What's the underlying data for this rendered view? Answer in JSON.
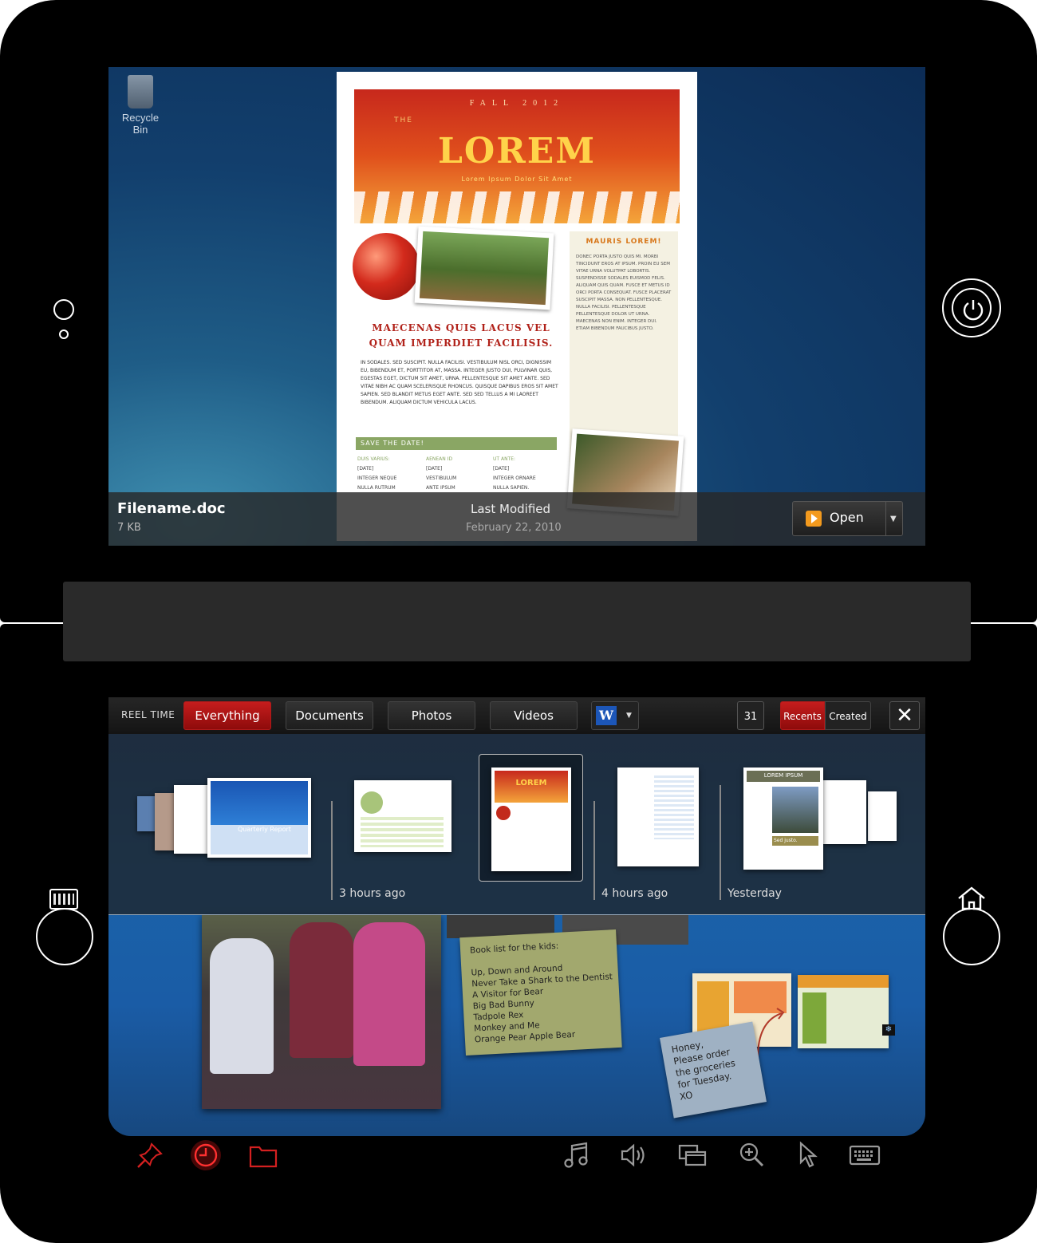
{
  "desktop": {
    "recycle_bin_label": "Recycle Bin"
  },
  "document_preview": {
    "season": "FALL 2012",
    "the": "THE",
    "title": "LOREM",
    "subtitle": "Lorem Ipsum Dolor Sit Amet",
    "headline": "Maecenas quis lacus vel quam imperdiet facilisis.",
    "body": "In sodales. Sed suscipit. Nulla facilisi. Vestibulum nisl orci, dignissim eu, bibendum et, porttitor at, massa. Integer justo dui, pulvinar quis, egestas eget, dictum sit amet, urna. Pellentesque sit amet ante. Sed vitae nibh ac quam scelerisque rhoncus. Quisque dapibus eros sit amet sapien. Sed blandit metus eget ante. Sed sed tellus a mi laoreet bibendum. Aliquam dictum vehicula lacus.",
    "sidebar_heading": "Mauris lorem!",
    "sidebar_text": "Donec porta justo quis mi. Morbi tincidunt eros at ipsum. Proin eu sem vitae urna volutpat lobortis. Suspendisse sodales euismod felis. Aliquam quis quam. Fusce et metus id orci porta consequat. Fusce placerat suscipit massa. Non pellentesque. Nulla facilisi. Pellentesque pellentesque dolor ut urna. Maecenas non enim. Integer dui. Etiam bibendum faucibus justo.",
    "save_the_date": "Save the Date!",
    "columns": [
      {
        "head": "Duis varius:",
        "lines": [
          "[Date]",
          "Integer neque",
          "nulla rutrum"
        ]
      },
      {
        "head": "Aenean id",
        "lines": [
          "[Date]",
          "Vestibulum",
          "ante ipsum"
        ]
      },
      {
        "head": "Ut ante:",
        "lines": [
          "[Date]",
          "Integer ornare",
          "nulla sapien."
        ]
      }
    ]
  },
  "file_info": {
    "filename": "Filename.doc",
    "size": "7 KB",
    "last_modified_label": "Last Modified",
    "last_modified_value": "February 22, 2010",
    "open_label": "Open"
  },
  "toolbar": {
    "title": "REEL TIME",
    "tabs": [
      "Everything",
      "Documents",
      "Photos",
      "Videos"
    ],
    "active_tab": "Everything",
    "calendar_day": "31",
    "recents_label": "Recents",
    "created_label": "Created",
    "close_glyph": "✕"
  },
  "timeline": {
    "groups": [
      {
        "label": ""
      },
      {
        "label": "3 hours ago"
      },
      {
        "label": ""
      },
      {
        "label": "4 hours ago"
      },
      {
        "label": "Yesterday"
      }
    ],
    "thumb_quarterly": "Quarterly Report",
    "thumb_lorem_ipsum": "LOREM IPSUM",
    "thumb_sed_justo": "Sed justo."
  },
  "notes": {
    "book_list": "Book list for the kids:\n\nUp, Down and Around\nNever Take a Shark to the Dentist\nA Visitor for Bear\nBig Bad Bunny\nTadpole Rex\nMonkey and Me\nOrange Pear Apple Bear",
    "grocery": "Honey,\nPlease order\nthe groceries\nfor Tuesday.\nXO"
  },
  "colors": {
    "accent_red": "#c51d1d",
    "bezel": "#000000",
    "desktop_blue": "#123f6d"
  },
  "icons": {
    "bottom_left": [
      "pin-icon",
      "clock-icon",
      "folder-icon"
    ],
    "bottom_right": [
      "music-icon",
      "volume-icon",
      "windows-icon",
      "zoom-icon",
      "pointer-icon",
      "keyboard-icon"
    ]
  }
}
